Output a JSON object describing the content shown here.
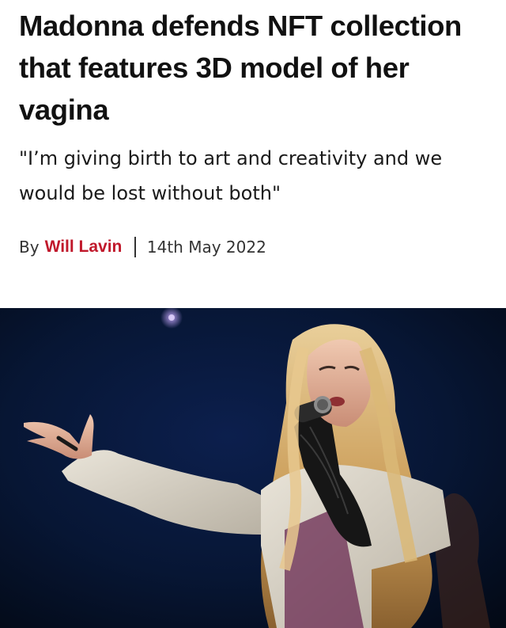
{
  "article": {
    "headline": "Madonna defends NFT collection that features 3D model of her vagina",
    "standfirst": "\"I’m giving birth to art and creativity and we would be lost without both\"",
    "byline": {
      "prefix": "By",
      "author": "Will Lavin",
      "date": "14th May 2022"
    }
  },
  "colors": {
    "author_link": "#c0182b",
    "stage_background": "#071432"
  },
  "hero_image": {
    "subject": "performer singing into a microphone on a dark blue stage"
  }
}
